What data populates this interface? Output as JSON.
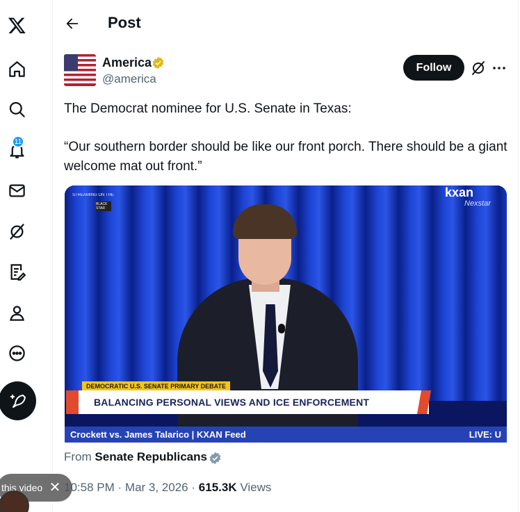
{
  "nav": {
    "items": [
      "x-logo",
      "home-icon",
      "search-icon",
      "notifications-icon",
      "messages-icon",
      "grok-icon",
      "lists-icon",
      "profile-icon",
      "more-icon"
    ],
    "notification_count": "11"
  },
  "header": {
    "title": "Post"
  },
  "author": {
    "name": "America",
    "handle": "@america",
    "follow_label": "Follow"
  },
  "post": {
    "line1": "The Democrat nominee for U.S. Senate in Texas:",
    "line2": "“Our southern border should be like our front porch. There should be a giant welcome mat out front.”"
  },
  "video": {
    "watermark": "STREAMING ON THE",
    "watermark_badge": "BLACK STAR",
    "logo": "kxan",
    "logo_sub": "Nexstar",
    "tag": "DEMOCRATIC U.S. SENATE PRIMARY DEBATE",
    "headline": "BALANCING PERSONAL VIEWS AND ICE ENFORCEMENT",
    "ticker": "Crockett vs. James Talarico | KXAN Feed",
    "live": "LIVE: U"
  },
  "source": {
    "prefix": "From",
    "name": "Senate Republicans"
  },
  "meta": {
    "time": "10:58 PM",
    "separator": "·",
    "date": "Mar 3, 2026",
    "views_count": "615.3K",
    "views_label": "Views"
  },
  "pip": {
    "label": "this video"
  },
  "colors": {
    "accent": "#1d9bf0",
    "text": "#0f1419",
    "muted": "#536471",
    "verified_gold": "#e2b719"
  }
}
